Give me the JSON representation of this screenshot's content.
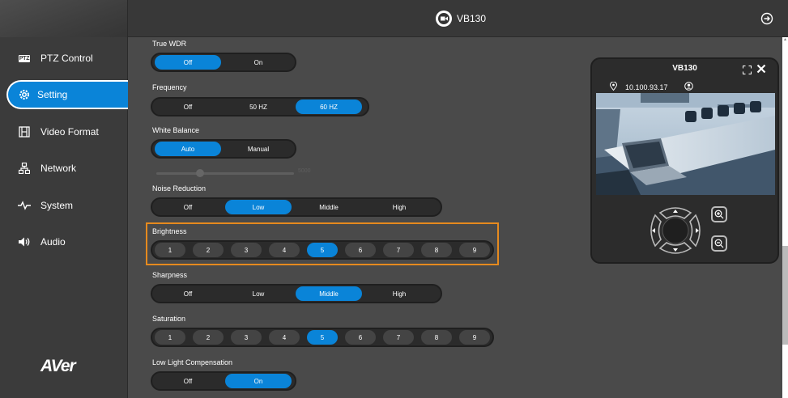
{
  "header": {
    "title": "VB130"
  },
  "sidebar": {
    "items": [
      {
        "label": "PTZ Control",
        "icon": "ptz-icon",
        "active": false
      },
      {
        "label": "Setting",
        "icon": "gear-icon",
        "active": true
      },
      {
        "label": "Video Format",
        "icon": "film-icon",
        "active": false
      },
      {
        "label": "Network",
        "icon": "network-icon",
        "active": false
      },
      {
        "label": "System",
        "icon": "pulse-icon",
        "active": false
      },
      {
        "label": "Audio",
        "icon": "speaker-icon",
        "active": false
      }
    ],
    "ptz_badge": "PTZ",
    "logo": "AVer"
  },
  "settings": {
    "true_wdr": {
      "label": "True WDR",
      "options": [
        "Off",
        "On"
      ],
      "selected": "Off"
    },
    "frequency": {
      "label": "Frequency",
      "options": [
        "Off",
        "50 HZ",
        "60 HZ"
      ],
      "selected": "60 HZ"
    },
    "white_balance": {
      "label": "White Balance",
      "options": [
        "Auto",
        "Manual"
      ],
      "selected": "Auto"
    },
    "noise_reduction": {
      "label": "Noise Reduction",
      "options": [
        "Off",
        "Low",
        "Middle",
        "High"
      ],
      "selected": "Low"
    },
    "brightness": {
      "label": "Brightness",
      "options": [
        "1",
        "2",
        "3",
        "4",
        "5",
        "6",
        "7",
        "8",
        "9"
      ],
      "selected": "5"
    },
    "sharpness": {
      "label": "Sharpness",
      "options": [
        "Off",
        "Low",
        "Middle",
        "High"
      ],
      "selected": "Middle"
    },
    "saturation": {
      "label": "Saturation",
      "options": [
        "1",
        "2",
        "3",
        "4",
        "5",
        "6",
        "7",
        "8",
        "9"
      ],
      "selected": "5"
    },
    "low_light": {
      "label": "Low Light Compensation",
      "options": [
        "Off",
        "On"
      ],
      "selected": "On"
    }
  },
  "wb_slider": {
    "value_text": "5000",
    "level": 0.3
  },
  "preview": {
    "title": "VB130",
    "ip": "10.100.93.17"
  },
  "colors": {
    "accent": "#0a84d8",
    "highlight": "#e68a1e",
    "bg": "#4a4a4a",
    "sidebar": "#3b3b3b"
  }
}
